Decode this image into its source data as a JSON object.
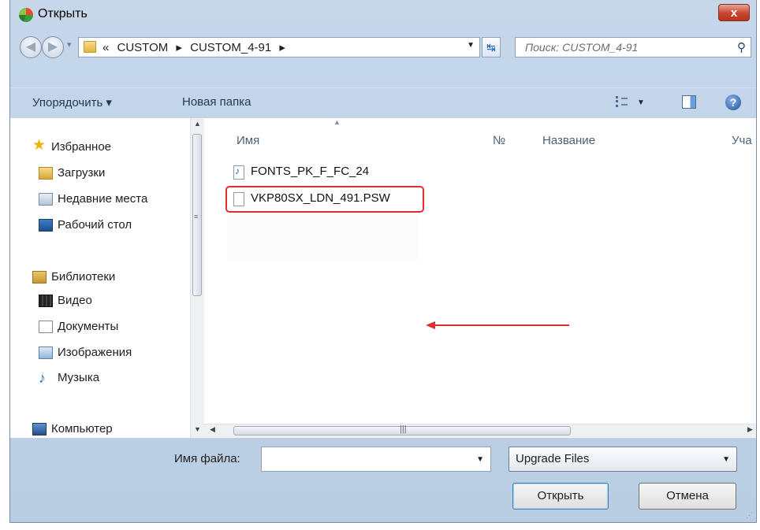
{
  "window": {
    "title": "Открыть",
    "close_label": "x"
  },
  "address": {
    "prefix": "«",
    "crumbs": [
      "CUSTOM",
      "CUSTOM_4-91"
    ],
    "separator": "▸",
    "refresh_glyph": "↹"
  },
  "search": {
    "placeholder": "Поиск: CUSTOM_4-91",
    "icon": "search-icon"
  },
  "toolbar": {
    "organize_label": "Упорядочить ▾",
    "new_folder_label": "Новая папка"
  },
  "nav": {
    "favorites": {
      "label": "Избранное",
      "items": [
        "Загрузки",
        "Недавние места",
        "Рабочий стол"
      ]
    },
    "libraries": {
      "label": "Библиотеки",
      "items": [
        "Видео",
        "Документы",
        "Изображения",
        "Музыка"
      ]
    },
    "computer": {
      "label": "Компьютер"
    }
  },
  "columns": [
    "Имя",
    "№",
    "Название",
    "Уча"
  ],
  "files": [
    {
      "name": "FONTS_PK_F_FC_24",
      "type": "sound",
      "highlighted": false
    },
    {
      "name": "VKP80SX_LDN_491.PSW",
      "type": "file",
      "highlighted": true
    }
  ],
  "bottom": {
    "filename_label": "Имя файла:",
    "filename_value": "",
    "filetype_value": "Upgrade Files",
    "open_label": "Открыть",
    "cancel_label": "Отмена"
  },
  "colors": {
    "highlight": "#e32c2c",
    "titlebar": "#c6d7ea"
  }
}
